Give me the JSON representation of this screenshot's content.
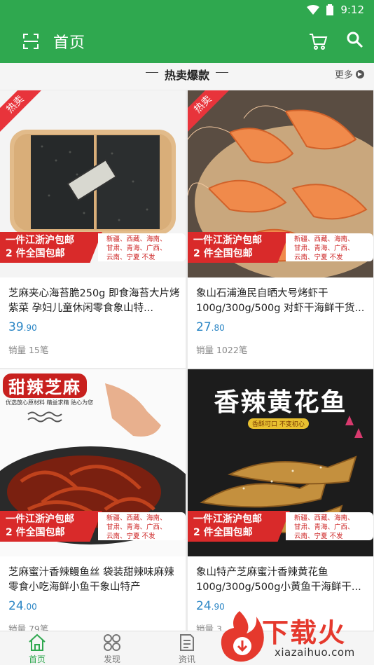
{
  "status": {
    "time": "9:12"
  },
  "appbar": {
    "title": "首页"
  },
  "section": {
    "title": "热卖爆款",
    "more": "更多"
  },
  "badge": {
    "hot": "热卖"
  },
  "shipping": {
    "line1": "一件江浙沪包邮",
    "line2": "2 件全国包邮",
    "regions_row1": "新疆、西藏、海南、",
    "regions_row2": "甘肃、青海、广西、",
    "regions_row3": "云南、宁夏  不发"
  },
  "products": [
    {
      "name": "芝麻夹心海苔脆250g 即食海苔大片烤紫菜 孕妇儿童休闲零食象山特...",
      "price_int": "39",
      "price_dec": ".90",
      "sales": "销量 15笔"
    },
    {
      "name": "象山石浦渔民自晒大号烤虾干100g/300g/500g 对虾干海鲜干货...",
      "price_int": "27",
      "price_dec": ".80",
      "sales": "销量 1022笔"
    },
    {
      "name": "芝麻蜜汁香辣鳗鱼丝 袋装甜辣味麻辣零食小吃海鲜小鱼干象山特产",
      "price_int": "24",
      "price_dec": ".00",
      "sales": "销量 79笔",
      "banner": "甜辣芝麻",
      "banner_sub": "优选放心原材料 精益求精 贴心为您"
    },
    {
      "name": "象山特产芝麻蜜汁香辣黄花鱼100g/300g/500g小黄鱼干海鲜干...",
      "price_int": "24",
      "price_dec": ".90",
      "sales": "销量 3",
      "banner": "香辣黄花鱼",
      "banner_sub": "香酥可口 不变初心"
    }
  ],
  "tabs": [
    {
      "label": "首页"
    },
    {
      "label": "发现"
    },
    {
      "label": "资讯"
    }
  ],
  "watermark": {
    "brand": "下载火",
    "url": "xiazaihuo.com"
  },
  "colors": {
    "primary": "#2fa84f",
    "price": "#2b86c5",
    "hot": "#e8343b"
  }
}
